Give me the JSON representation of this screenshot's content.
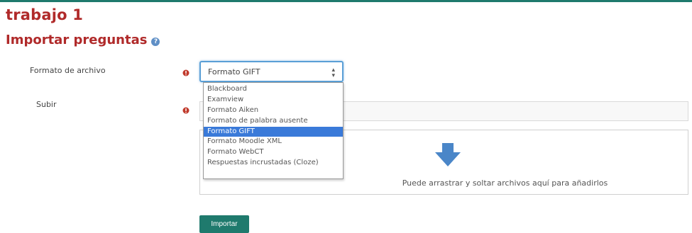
{
  "page": {
    "title": "trabajo 1",
    "section_title": "Importar preguntas"
  },
  "colors": {
    "heading": "#b02a2a",
    "accent": "#1f7a6d",
    "selection": "#3a7ad9"
  },
  "form": {
    "file_format_label": "Formato de archivo",
    "upload_label": "Subir",
    "file_format_select": {
      "selected": "Formato GIFT",
      "options": [
        "Blackboard",
        "Examview",
        "Formato Aiken",
        "Formato de palabra ausente",
        "Formato GIFT",
        "Formato Moodle XML",
        "Formato WebCT",
        "Respuestas incrustadas (Cloze)"
      ],
      "highlighted_index": 4
    },
    "dropzone_text": "Puede arrastrar y soltar archivos aquí para añadirlos",
    "import_button": "Importar"
  },
  "icons": {
    "help": "help-circle-icon",
    "required": "exclamation-circle-icon",
    "upload_arrow": "arrow-down-icon",
    "select_caret": "up-down-caret-icon"
  }
}
